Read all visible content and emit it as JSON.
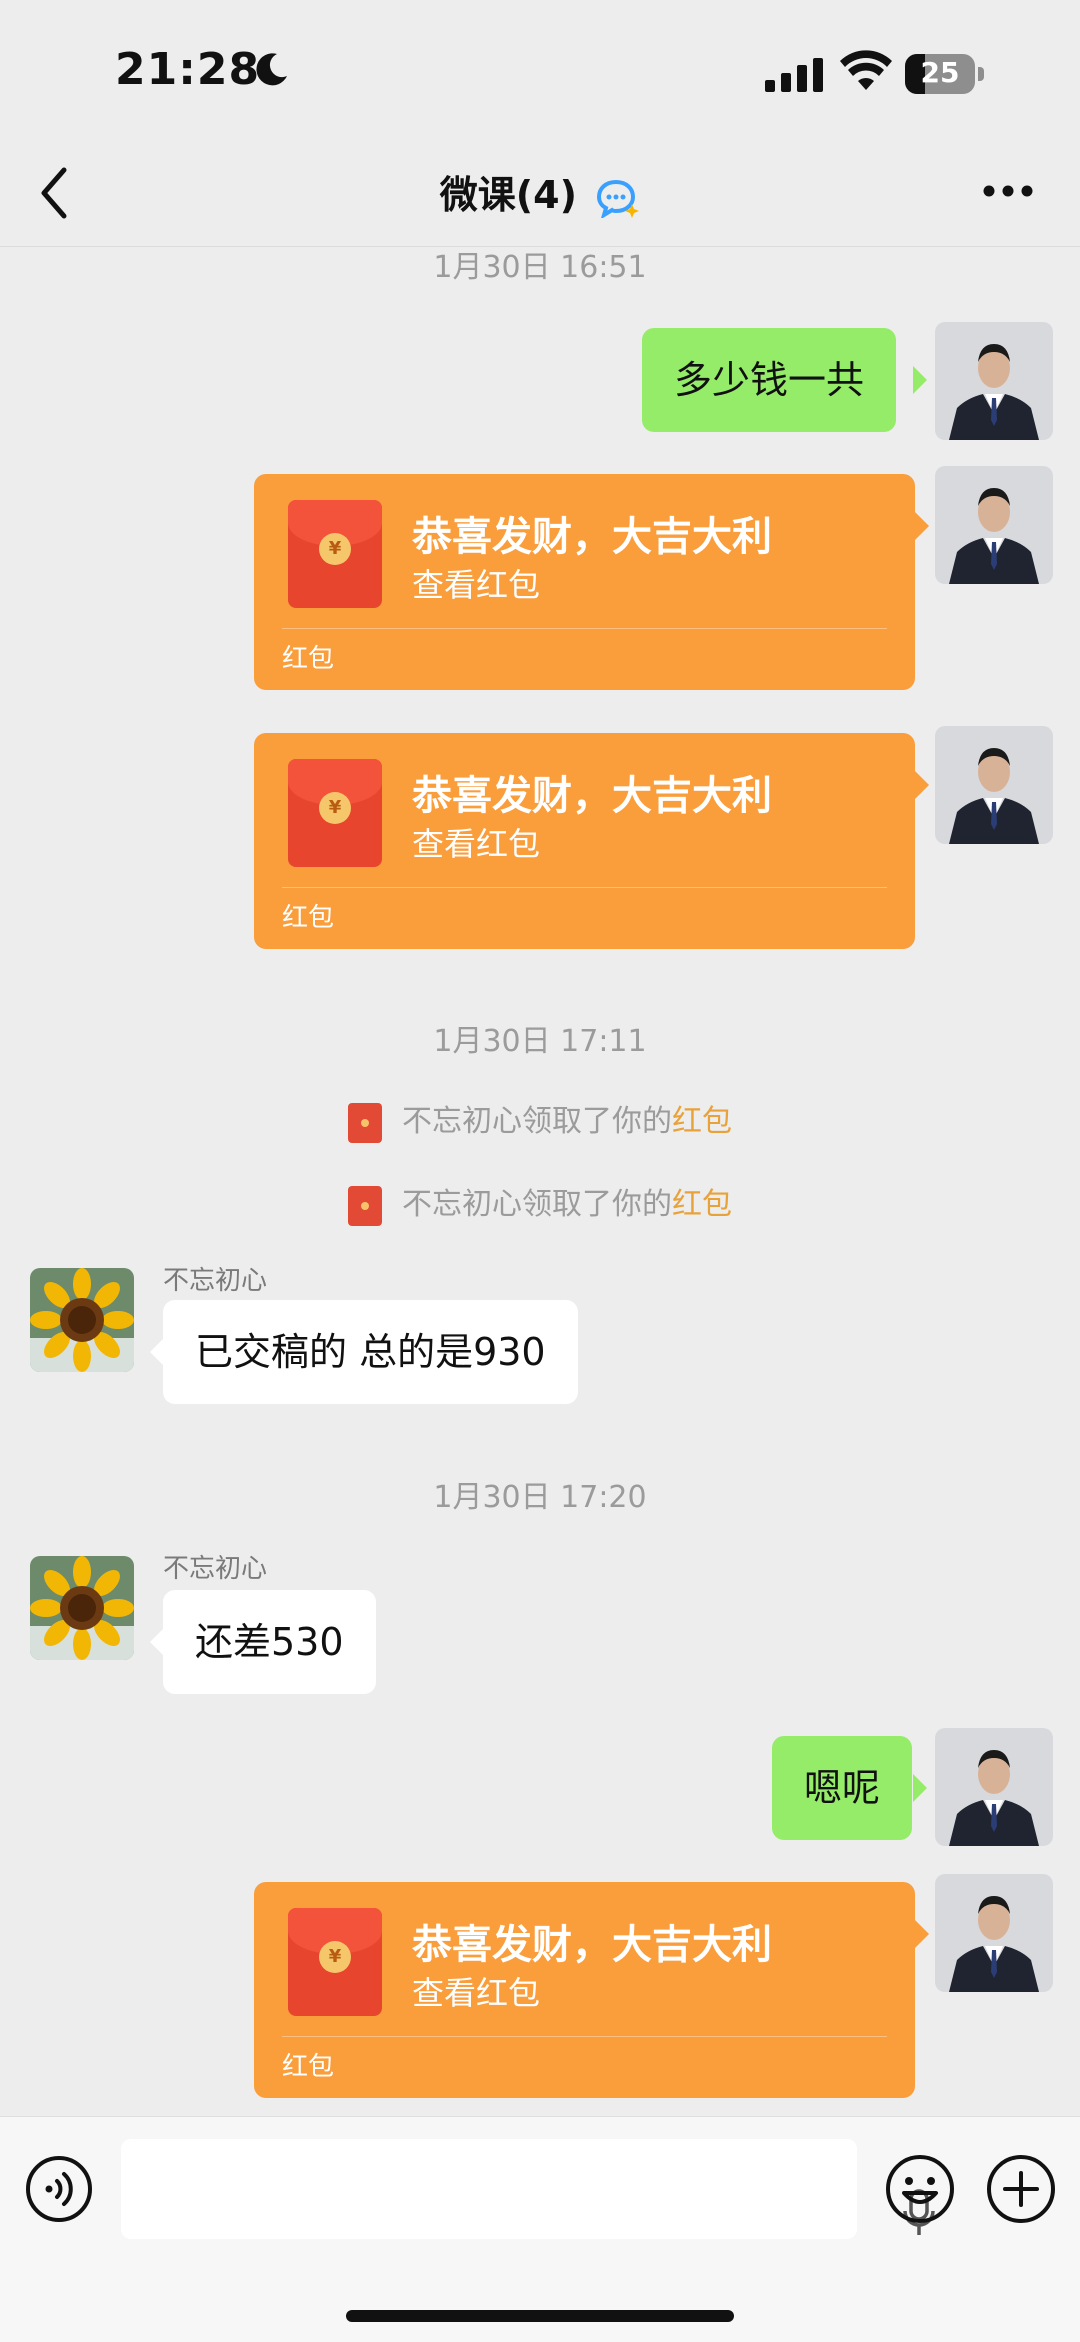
{
  "status": {
    "time": "21:28",
    "battery": "25"
  },
  "nav": {
    "title": "微课(4)"
  },
  "chat": {
    "timestamps": [
      "1月30日 16:51",
      "1月30日 17:11",
      "1月30日 17:20"
    ],
    "msg_1": "多少钱一共",
    "red_packet": {
      "title": "恭喜发财，大吉大利",
      "subtitle": "查看红包",
      "footer": "红包",
      "coin": "¥"
    },
    "system": {
      "text": "不忘初心领取了你的",
      "link": "红包"
    },
    "sender_name": "不忘初心",
    "msg_2": "已交稿的  总的是930",
    "msg_3": "还差530",
    "msg_4": "嗯呢"
  },
  "colors": {
    "green_bubble": "#95EC69",
    "red_packet": "#FA9D3B",
    "background": "#EDEDED"
  }
}
